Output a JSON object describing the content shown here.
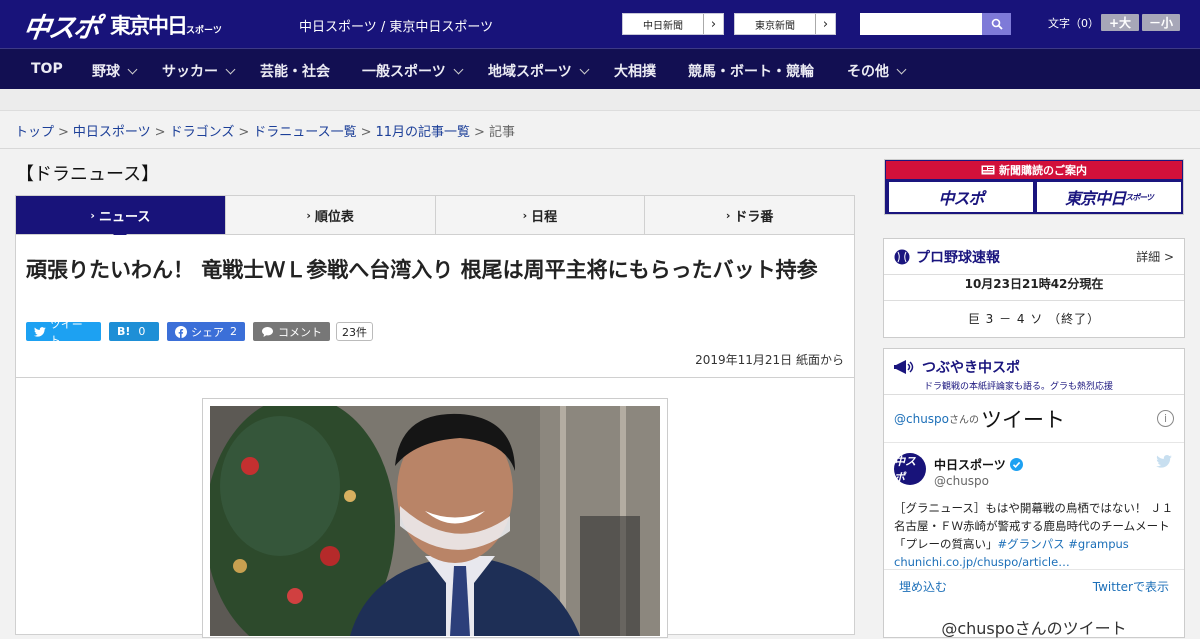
{
  "header": {
    "logo_chuspo": "中スポ",
    "logo_tokyo": "東京中日",
    "logo_tokyo_small": "スポーツ",
    "site_names": "中日スポーツ / 東京中日スポーツ",
    "paper_buttons": [
      "中日新聞",
      "東京新聞"
    ],
    "font_label": "文字（0）",
    "font_bigger": "+大",
    "font_smaller": "－小"
  },
  "nav": {
    "items": [
      {
        "label": "TOP",
        "dropdown": false
      },
      {
        "label": "野球",
        "dropdown": true
      },
      {
        "label": "サッカー",
        "dropdown": true
      },
      {
        "label": "芸能・社会",
        "dropdown": false
      },
      {
        "label": "一般スポーツ",
        "dropdown": true
      },
      {
        "label": "地域スポーツ",
        "dropdown": true
      },
      {
        "label": "大相撲",
        "dropdown": false
      },
      {
        "label": "競馬・ボート・競輪",
        "dropdown": false
      },
      {
        "label": "その他",
        "dropdown": true
      }
    ]
  },
  "breadcrumb": {
    "links": [
      "トップ",
      "中日スポーツ",
      "ドラゴンズ",
      "ドラニュース一覧",
      "11月の記事一覧"
    ],
    "current": "記事",
    "separator": ">"
  },
  "section_title": "【ドラニュース】",
  "tabs": [
    {
      "label": "ニュース",
      "active": true
    },
    {
      "label": "順位表",
      "active": false
    },
    {
      "label": "日程",
      "active": false
    },
    {
      "label": "ドラ番",
      "active": false
    }
  ],
  "article": {
    "headline": "頑張りたいわん！ 竜戦士ＷＬ参戦へ台湾入り 根尾は周平主将にもらったバット持参",
    "share": {
      "tweet": "ツイート",
      "hatena_label": "B!",
      "hatena_count": "0",
      "facebook": "シェア",
      "facebook_count": "2",
      "comment": "コメント",
      "comment_count": "23件"
    },
    "dateline": "2019年11月21日 紙面から"
  },
  "sidebar": {
    "ad_top": "新聞購読のご案内",
    "ad_left": "中スポ",
    "ad_right": "東京中日",
    "ad_right_small": "スポーツ",
    "baseball": {
      "title": "プロ野球速報",
      "more": "詳細 >",
      "time": "10月23日21時42分現在",
      "score": "巨 3 － 4 ソ （終了）"
    },
    "tsubuyaki": {
      "title": "つぶやき中スポ",
      "subtitle": "ドラ観戦の本紙評論家も語る。グラも熱烈応援",
      "timeline_handle": "@chuspo",
      "timeline_rest": "さんの",
      "timeline_big": "ツイート",
      "tweet_name": "中日スポーツ",
      "tweet_user": "@chuspo",
      "tweet_avatar": "中スポ",
      "tweet_text": "［グラニュース］もはや開幕戦の鳥栖ではない！ Ｊ１名古屋・ＦＷ赤崎が警戒する鹿島時代のチームメート「プレーの質高い」",
      "tweet_tag1": "#グランパス",
      "tweet_tag2": "#grampus",
      "tweet_link": "chunichi.co.jp/chuspo/article…",
      "embed": "埋め込む",
      "view_on_twitter": "Twitterで表示",
      "next_heading": "@chuspoさんのツイート"
    }
  }
}
